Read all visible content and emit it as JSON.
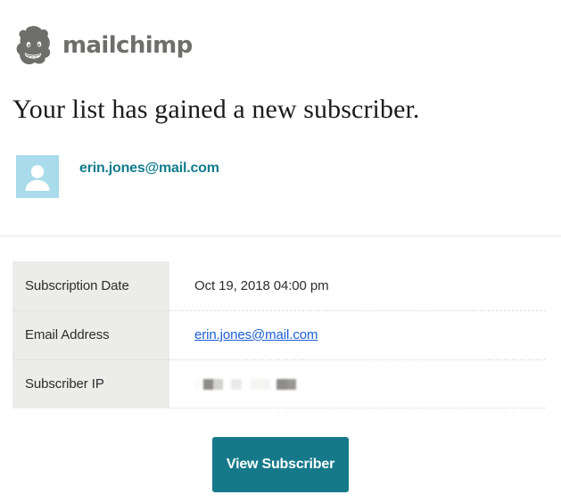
{
  "brand": {
    "logo_icon": "mailchimp-freddie-icon",
    "wordmark": "mailchimp",
    "wordmark_color": "#6e6e6a"
  },
  "headline": "Your list has gained a new subscriber.",
  "identity": {
    "avatar_icon": "user-avatar-icon",
    "avatar_bg": "#a9dbea",
    "email": "erin.jones@mail.com",
    "email_color": "#127c8c"
  },
  "details": {
    "rows": [
      {
        "label": "Subscription Date",
        "value": "Oct 19, 2018 04:00 pm",
        "type": "text"
      },
      {
        "label": "Email Address",
        "value": "erin.jones@mail.com",
        "type": "link",
        "link_color": "#1c5fd4"
      },
      {
        "label": "Subscriber IP",
        "value": "",
        "type": "redacted",
        "redacted_blocks": [
          {
            "width": 10,
            "color": "#fbfbfa"
          },
          {
            "width": 11,
            "color": "#8e8c89"
          },
          {
            "width": 11,
            "color": "#d2d1cd"
          },
          {
            "width": 9,
            "color": "#ffffff"
          },
          {
            "width": 12,
            "color": "#ebeae8"
          },
          {
            "width": 10,
            "color": "#ffffff"
          },
          {
            "width": 22,
            "color": "#f5f4f2"
          },
          {
            "width": 7,
            "color": "#ffffff"
          },
          {
            "width": 12,
            "color": "#8e8c89"
          },
          {
            "width": 10,
            "color": "#9a9895"
          }
        ]
      }
    ],
    "label_bg": "#ececea"
  },
  "cta": {
    "label": "View Subscriber",
    "background": "#15798a",
    "text_color": "#ffffff"
  }
}
